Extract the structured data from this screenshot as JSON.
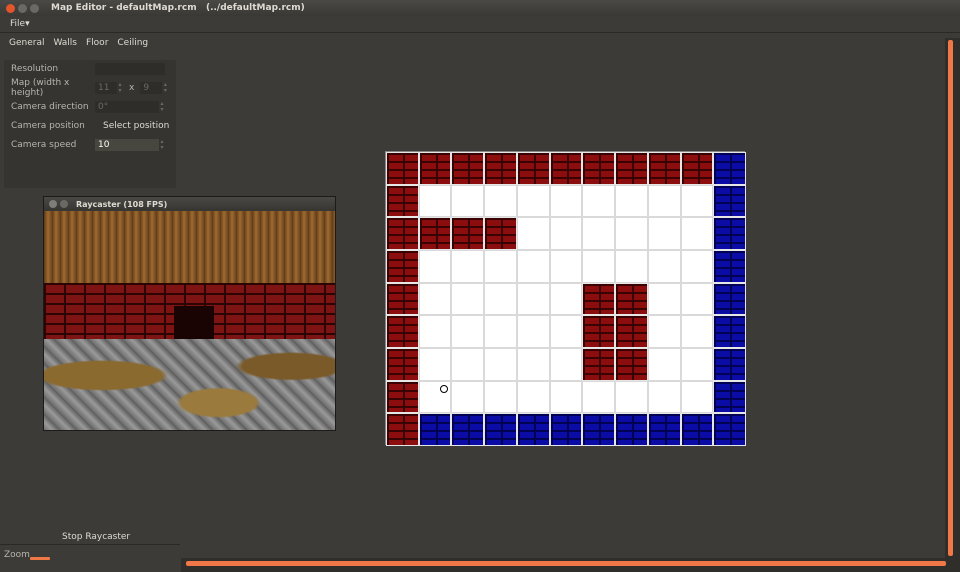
{
  "window": {
    "title": "Map Editor - defaultMap.rcm",
    "path": "(../defaultMap.rcm)"
  },
  "menu": {
    "file": "File"
  },
  "tabs": [
    "General",
    "Walls",
    "Floor",
    "Ceiling"
  ],
  "settings": {
    "resolution_label": "Resolution",
    "map_size_label": "Map (width x height)",
    "map_width": "11",
    "map_x": "x",
    "map_height": "9",
    "camera_direction_label": "Camera direction",
    "camera_direction": "0°",
    "camera_position_label": "Camera position",
    "select_position": "Select position",
    "camera_speed_label": "Camera speed",
    "camera_speed": "10"
  },
  "raycaster": {
    "title": "Raycaster (108 FPS)"
  },
  "stop_raycaster": "Stop Raycaster",
  "zoom_label": "Zoom",
  "map": {
    "cols": 11,
    "rows": 9,
    "grid": [
      "RRRRRRRRRRB",
      "R.........B",
      "RRRR......B",
      "R.........B",
      "R.....RR..B",
      "R.....RR..B",
      "R.....RR..B",
      "R.........B",
      "RBBBBBBBBBB"
    ]
  },
  "colors": {
    "accent": "#f07746",
    "red_wall": "#8b0d0d",
    "blue_wall": "#0b0ba6",
    "background": "#3c3b37"
  }
}
